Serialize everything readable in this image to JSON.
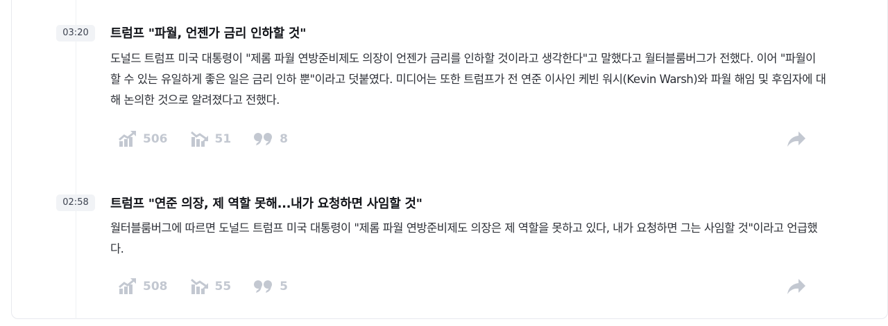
{
  "items": [
    {
      "time": "03:20",
      "title": "트럼프 \"파월, 언젠가 금리 인하할 것\"",
      "body": "도널드 트럼프 미국 대통령이 \"제롬 파월 연방준비제도 의장이 언젠가 금리를 인하할 것이라고 생각한다\"고 말했다고 월터블룸버그가 전했다. 이어 \"파월이 할 수 있는 유일하게 좋은 일은 금리 인하 뿐\"이라고 덧붙였다. 미디어는 또한 트럼프가 전 연준 이사인 케빈 워시(Kevin Warsh)와 파월 해임 및 후임자에 대해 논의한 것으로 알려졌다고 전했다.",
      "bullish_count": "506",
      "bearish_count": "51",
      "comment_count": "8"
    },
    {
      "time": "02:58",
      "title": "트럼프 \"연준 의장, 제 역할 못해...내가 요청하면 사임할 것\"",
      "body": "월터블룸버그에 따르면 도널드 트럼프 미국 대통령이 \"제롬 파월 연방준비제도 의장은  제 역할을 못하고 있다, 내가 요청하면 그는 사임할 것\"이라고 언급했다.",
      "bullish_count": "508",
      "bearish_count": "55",
      "comment_count": "5"
    }
  ],
  "icons": {
    "bullish": "trend-up-icon",
    "bearish": "trend-down-icon",
    "comment": "quote-icon",
    "share": "share-arrow-icon"
  },
  "colors": {
    "icon_muted": "#c3c8d1",
    "badge_bg": "#f1f3f6"
  }
}
